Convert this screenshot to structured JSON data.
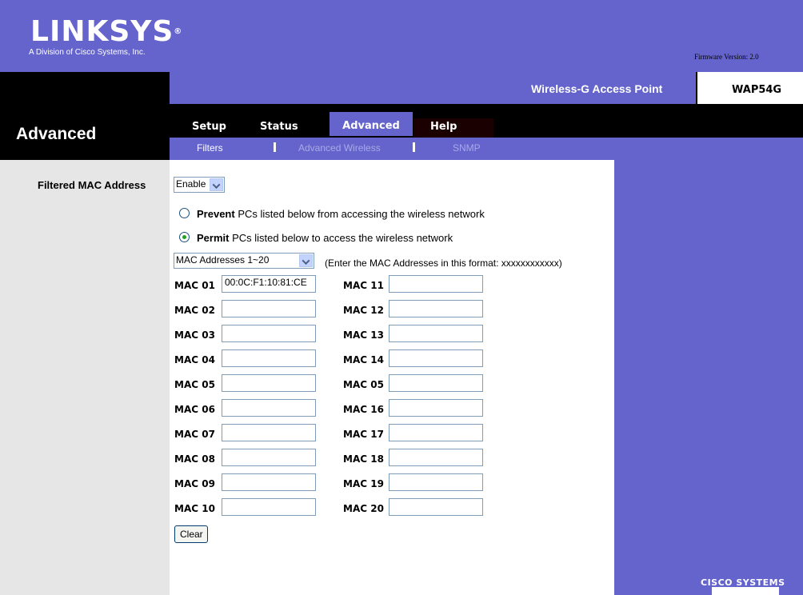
{
  "header": {
    "brand": "LINKSYS",
    "brand_mark": "®",
    "division": "A Division of Cisco Systems, Inc.",
    "firmware": "Firmware Version: 2.0",
    "product_name": "Wireless-G Access Point",
    "model": "WAP54G",
    "accent_color": "#6464cc"
  },
  "section_title": "Advanced",
  "tabs": [
    {
      "label": "Setup"
    },
    {
      "label": "Status"
    },
    {
      "label": "Advanced",
      "selected": true
    },
    {
      "label": "Help"
    }
  ],
  "subtabs": [
    {
      "label": "Filters",
      "selected": true
    },
    {
      "label": "Advanced Wireless"
    },
    {
      "label": "SNMP"
    }
  ],
  "filter": {
    "label": "Filtered MAC Address",
    "enable_value": "Enable",
    "prevent_bold": "Prevent",
    "prevent_text": " PCs listed below from accessing the wireless network",
    "permit_bold": "Permit",
    "permit_text": " PCs listed below to access the wireless network",
    "selected_mode": "permit",
    "range_value": "MAC Addresses 1~20",
    "format_hint": "(Enter the MAC Addresses in this format: xxxxxxxxxxxx)",
    "clear_label": "Clear"
  },
  "mac_left": [
    {
      "label": "MAC 01",
      "value": "00:0C:F1:10:81:CE"
    },
    {
      "label": "MAC 02",
      "value": ""
    },
    {
      "label": "MAC 03",
      "value": ""
    },
    {
      "label": "MAC 04",
      "value": ""
    },
    {
      "label": "MAC 05",
      "value": ""
    },
    {
      "label": "MAC 06",
      "value": ""
    },
    {
      "label": "MAC 07",
      "value": ""
    },
    {
      "label": "MAC 08",
      "value": ""
    },
    {
      "label": "MAC 09",
      "value": ""
    },
    {
      "label": "MAC 10",
      "value": ""
    }
  ],
  "mac_right": [
    {
      "label": "MAC 11",
      "value": ""
    },
    {
      "label": "MAC 12",
      "value": ""
    },
    {
      "label": "MAC 13",
      "value": ""
    },
    {
      "label": "MAC 14",
      "value": ""
    },
    {
      "label": "MAC 05",
      "value": ""
    },
    {
      "label": "MAC 16",
      "value": ""
    },
    {
      "label": "MAC 17",
      "value": ""
    },
    {
      "label": "MAC 18",
      "value": ""
    },
    {
      "label": "MAC 19",
      "value": ""
    },
    {
      "label": "MAC 20",
      "value": ""
    }
  ],
  "footer": {
    "cisco": "CISCO SYSTEMS"
  }
}
